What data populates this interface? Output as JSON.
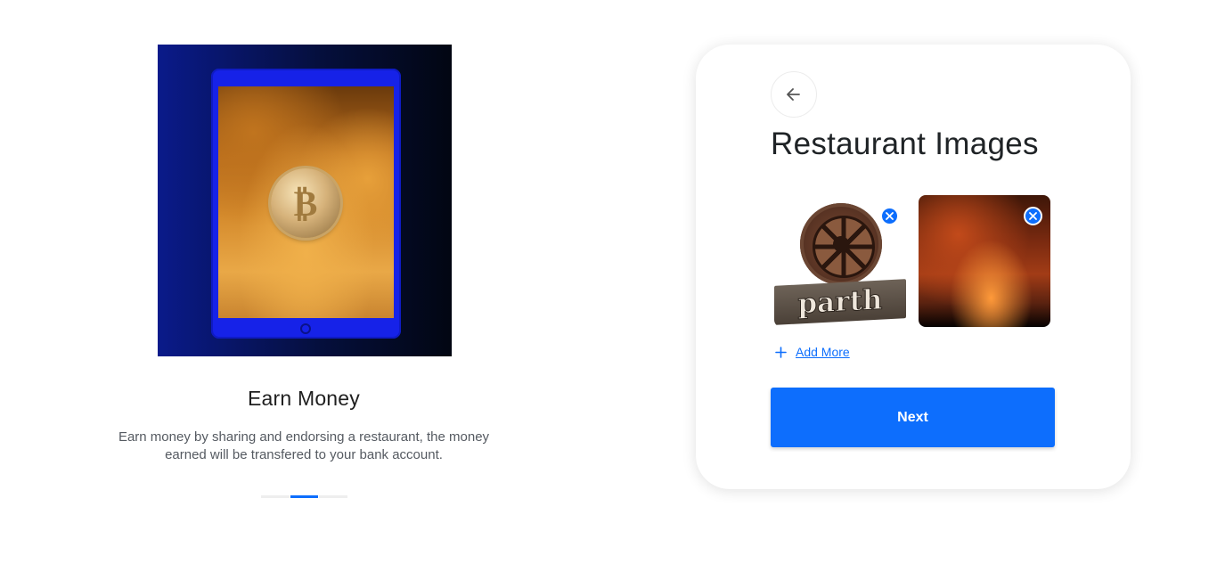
{
  "intro": {
    "title": "Earn Money",
    "description": "Earn money by sharing and endorsing a restaurant, the money earned will be transfered to your bank account.",
    "image_icon": "bitcoin-on-tablet",
    "slide_indicator": {
      "count": 3,
      "active_index": 1
    }
  },
  "card": {
    "back_icon": "arrow-left-icon",
    "title": "Restaurant Images",
    "images": [
      {
        "name": "restaurant-logo-image",
        "logo_text": "parth",
        "remove_icon": "close-circle-icon"
      },
      {
        "name": "restaurant-ambience-image",
        "remove_icon": "close-circle-icon"
      }
    ],
    "add_more_label": "Add More",
    "add_more_icon": "plus-icon",
    "next_label": "Next"
  },
  "colors": {
    "accent": "#0d6efd",
    "text_primary": "#1f2326",
    "text_secondary": "#555a61"
  }
}
